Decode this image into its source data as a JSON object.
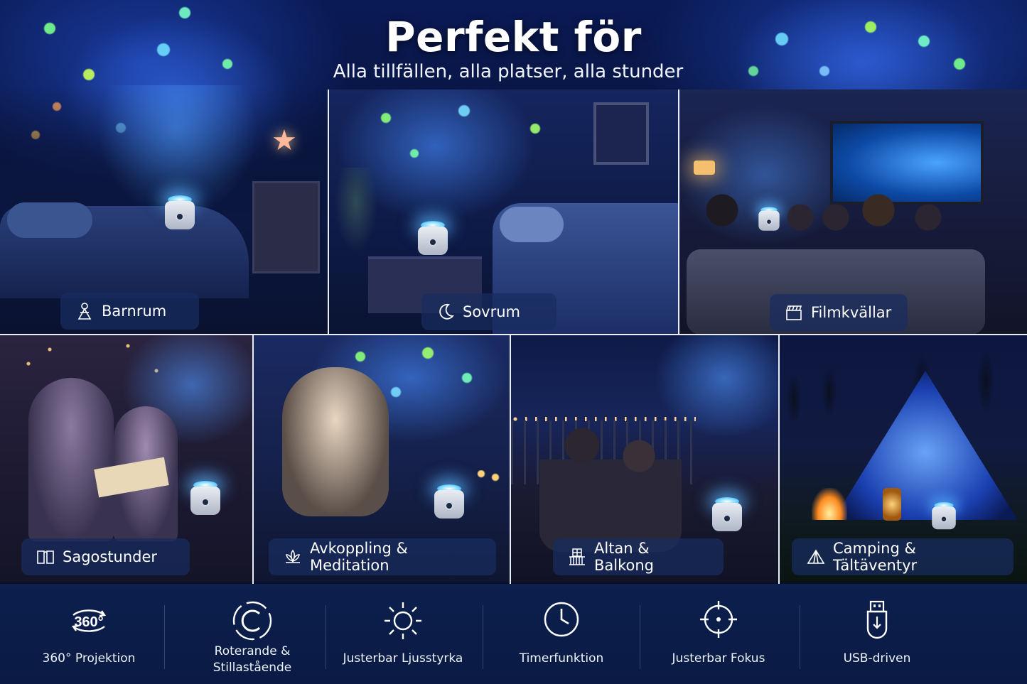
{
  "header": {
    "title": "Perfekt för",
    "subtitle": "Alla tillfällen, alla platser, alla stunder"
  },
  "scenes": [
    {
      "label": "Barnrum",
      "icon": "child-icon"
    },
    {
      "label": "Sovrum",
      "icon": "moon-icon"
    },
    {
      "label": "Filmkvällar",
      "icon": "clapperboard-icon"
    },
    {
      "label": "Sagostunder",
      "icon": "book-icon"
    },
    {
      "label": "Avkoppling & Meditation",
      "icon": "lotus-icon"
    },
    {
      "label": "Altan & Balkong",
      "icon": "balcony-icon"
    },
    {
      "label": "Camping & Tältäventyr",
      "icon": "tent-icon"
    }
  ],
  "features": [
    {
      "label": "360° Projektion",
      "icon": "360-icon",
      "icon_text": "360°"
    },
    {
      "label": "Roterande & Stillastående",
      "line1": "Roterande &",
      "line2": "Stillastående",
      "icon": "rotate-icon"
    },
    {
      "label": "Justerbar Ljusstyrka",
      "icon": "sun-icon"
    },
    {
      "label": "Timerfunktion",
      "icon": "clock-icon"
    },
    {
      "label": "Justerbar Fokus",
      "icon": "focus-target-icon"
    },
    {
      "label": "USB-driven",
      "icon": "usb-icon"
    }
  ],
  "colors": {
    "background": "#06102a",
    "label_bg": "#182c60",
    "glow": "#50aaff",
    "feature_bar": "#0c1f4d"
  }
}
